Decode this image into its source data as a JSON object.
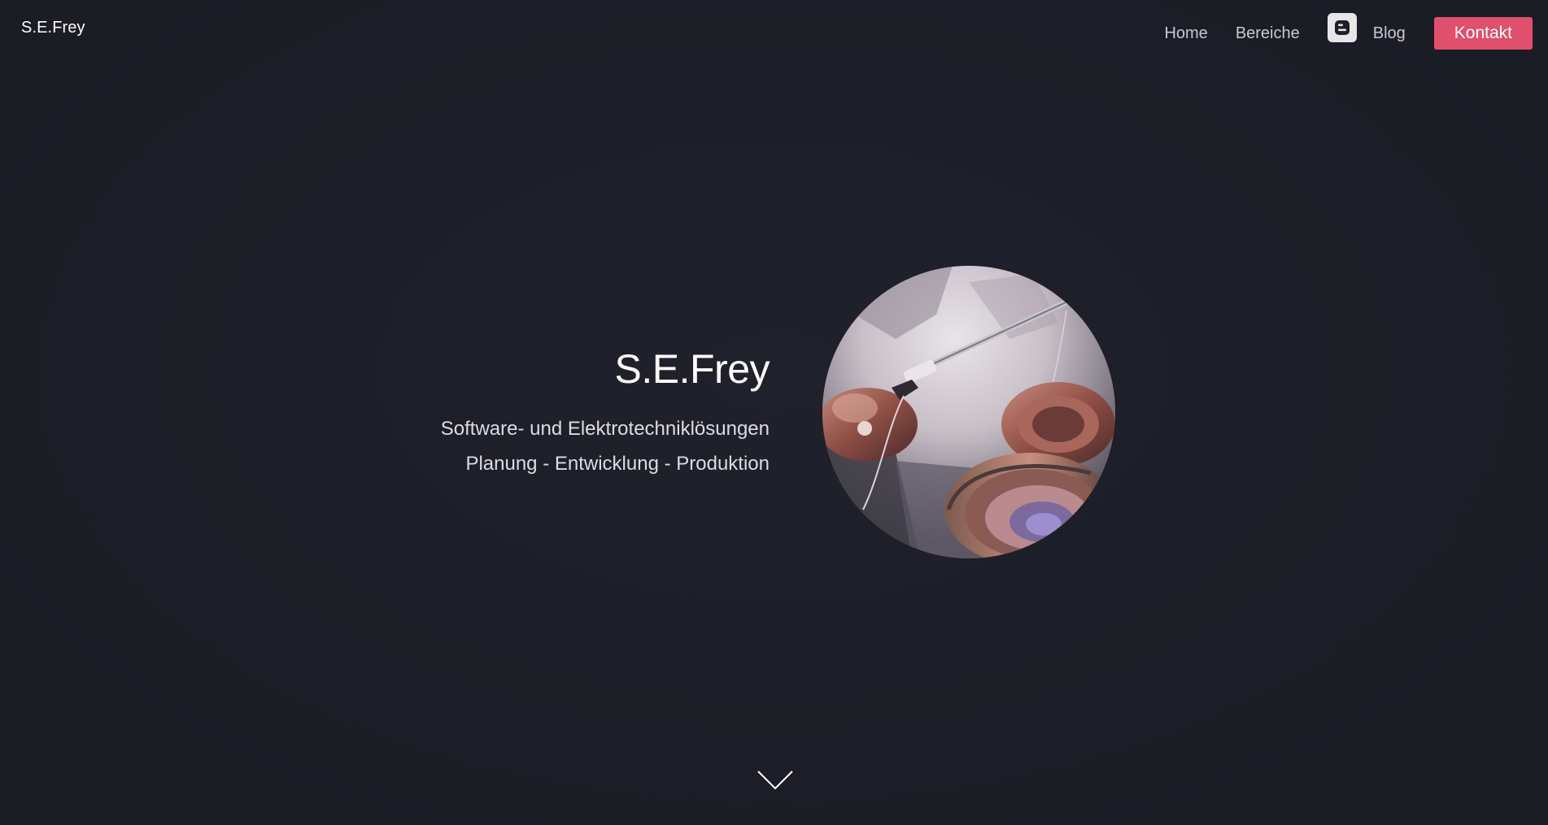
{
  "brand": {
    "name": "S.E.Frey"
  },
  "nav": {
    "items": [
      {
        "label": "Home"
      },
      {
        "label": "Bereiche"
      },
      {
        "label": "Blog",
        "icon": "blogger-icon"
      }
    ],
    "contact_label": "Kontakt"
  },
  "hero": {
    "title": "S.E.Frey",
    "subtitle_1": "Software- und Elektrotechniklösungen",
    "subtitle_2": "Planung - Entwicklung - Produktion",
    "image_icon": "hero-photo-soldering",
    "scroll_icon": "chevron-down-icon"
  },
  "colors": {
    "background": "#1d1e27",
    "accent": "#e0506c",
    "nav_text": "#c9c9cf",
    "title_text": "#ffffff"
  }
}
